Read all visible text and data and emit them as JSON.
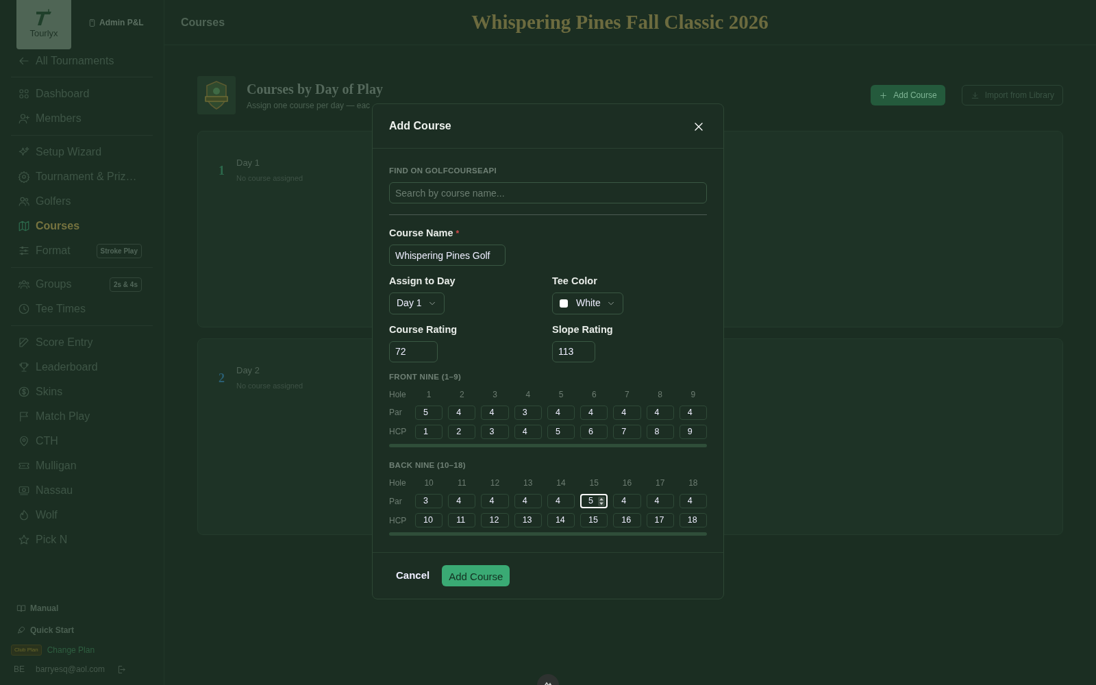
{
  "sidebar": {
    "logo": "Tourlyx",
    "account": "Admin P&L",
    "back_link": "All Tournaments",
    "sections": [
      [
        {
          "label": "Dashboard",
          "selected": false
        },
        {
          "label": "Members",
          "selected": false
        }
      ],
      [
        {
          "label": "Setup Wizard",
          "selected": false
        },
        {
          "label": "Tournament & Priz…",
          "selected": false
        },
        {
          "label": "Golfers",
          "selected": false
        },
        {
          "label": "Courses",
          "selected": true
        },
        {
          "label": "Format",
          "selected": false,
          "badge": "Stroke Play"
        }
      ],
      [
        {
          "label": "Groups",
          "selected": false,
          "badge": "2s & 4s"
        },
        {
          "label": "Tee Times",
          "selected": false
        }
      ],
      [
        {
          "label": "Score Entry",
          "selected": false
        },
        {
          "label": "Leaderboard",
          "selected": false
        },
        {
          "label": "Skins",
          "selected": false
        },
        {
          "label": "Match Play",
          "selected": false
        },
        {
          "label": "CTH",
          "selected": false
        },
        {
          "label": "Mulligan",
          "selected": false
        },
        {
          "label": "Nassau",
          "selected": false
        },
        {
          "label": "Wolf",
          "selected": false
        },
        {
          "label": "Pick N",
          "selected": false
        }
      ]
    ],
    "footer_links": [
      "Manual",
      "Quick Start"
    ],
    "plan": {
      "badge": "Club Plan",
      "link": "Change Plan"
    },
    "user": {
      "initials": "BE",
      "email": "barryesq@aol.com"
    }
  },
  "header": {
    "page": "Courses",
    "title": "Whispering Pines Fall Classic 2026"
  },
  "content": {
    "heading": "Courses by Day of Play",
    "subtitle": "Assign one course per day — eac",
    "buttons": [
      "Add Course",
      "Import from Library"
    ],
    "days": [
      {
        "number": "1",
        "color": "#2c6a4c",
        "title": "Day 1",
        "status": "No course assigned"
      },
      {
        "number": "2",
        "color": "#2a5f73",
        "title": "Day 2",
        "status": "No course assigned"
      }
    ]
  },
  "modal": {
    "title": "Add Course",
    "search": {
      "label": "FIND ON GOLFCOURSEAPI",
      "placeholder": "Search by course name..."
    },
    "course_name": {
      "label": "Course Name",
      "required_mark": "*",
      "value": "Whispering Pines Golf"
    },
    "assign_day": {
      "label": "Assign to Day",
      "value": "Day 1"
    },
    "tee_color": {
      "label": "Tee Color",
      "value": "White"
    },
    "course_rating": {
      "label": "Course Rating",
      "value": "72"
    },
    "slope_rating": {
      "label": "Slope Rating",
      "value": "113"
    },
    "nines": [
      {
        "label": "FRONT NINE (1–9)",
        "row_labels": [
          "Hole",
          "Par",
          "HCP"
        ],
        "holes": [
          {
            "hole": "1",
            "par": "5",
            "hcp": "1",
            "par_focused": false
          },
          {
            "hole": "2",
            "par": "4",
            "hcp": "2",
            "par_focused": false
          },
          {
            "hole": "3",
            "par": "4",
            "hcp": "3",
            "par_focused": false
          },
          {
            "hole": "4",
            "par": "3",
            "hcp": "4",
            "par_focused": false
          },
          {
            "hole": "5",
            "par": "4",
            "hcp": "5",
            "par_focused": false
          },
          {
            "hole": "6",
            "par": "4",
            "hcp": "6",
            "par_focused": false
          },
          {
            "hole": "7",
            "par": "4",
            "hcp": "7",
            "par_focused": false
          },
          {
            "hole": "8",
            "par": "4",
            "hcp": "8",
            "par_focused": false
          },
          {
            "hole": "9",
            "par": "4",
            "hcp": "9",
            "par_focused": false
          }
        ]
      },
      {
        "label": "BACK NINE (10–18)",
        "row_labels": [
          "Hole",
          "Par",
          "HCP"
        ],
        "holes": [
          {
            "hole": "10",
            "par": "3",
            "hcp": "10",
            "par_focused": false
          },
          {
            "hole": "11",
            "par": "4",
            "hcp": "11",
            "par_focused": false
          },
          {
            "hole": "12",
            "par": "4",
            "hcp": "12",
            "par_focused": false
          },
          {
            "hole": "13",
            "par": "4",
            "hcp": "13",
            "par_focused": false
          },
          {
            "hole": "14",
            "par": "4",
            "hcp": "14",
            "par_focused": false
          },
          {
            "hole": "15",
            "par": "5",
            "hcp": "15",
            "par_focused": true
          },
          {
            "hole": "16",
            "par": "4",
            "hcp": "16",
            "par_focused": false
          },
          {
            "hole": "17",
            "par": "4",
            "hcp": "17",
            "par_focused": false
          },
          {
            "hole": "18",
            "par": "4",
            "hcp": "18",
            "par_focused": false
          }
        ]
      }
    ],
    "cancel": "Cancel",
    "submit": "Add Course"
  }
}
